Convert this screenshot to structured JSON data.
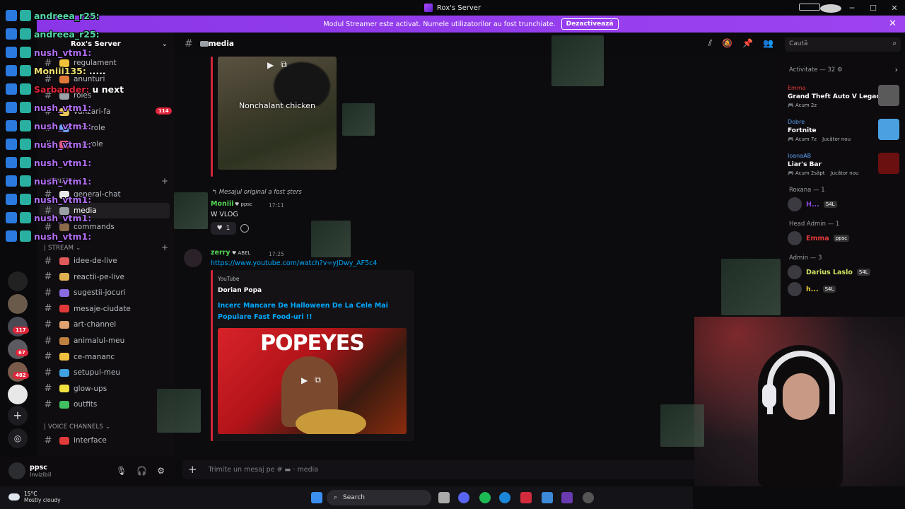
{
  "window": {
    "title": "Rox's Server"
  },
  "banner": {
    "text": "Modul Streamer este activat. Numele utilizatorilor au fost trunchiate.",
    "button": "Dezactivează"
  },
  "rail": {
    "badges": [
      "117",
      "67",
      "482"
    ]
  },
  "server": {
    "name": "Rox's Server",
    "channels_top": [
      {
        "label": "regulament",
        "color": "#f0c23b"
      },
      {
        "label": "anunturi",
        "color": "#e07a3b"
      },
      {
        "label": "roles",
        "color": "#9aa0a6"
      },
      {
        "label": "vanzari-fa",
        "color": "#e7c55a"
      },
      {
        "label": "kick-role",
        "color": "#6aa0f0"
      },
      {
        "label": "self-role",
        "color": "#e05a8a"
      }
    ],
    "unread_badge": "114",
    "cat_general": "| GENERAL |",
    "channels_general": [
      {
        "label": "general-chat",
        "color": "#e7e7e7"
      },
      {
        "label": "media",
        "color": "#9aa0a6"
      },
      {
        "label": "commands",
        "color": "#8a6a4a"
      }
    ],
    "cat_stream": "| STREAM ⌄",
    "channels_stream": [
      {
        "label": "idee-de-live",
        "color": "#e05a5a"
      },
      {
        "label": "reactii-pe-live",
        "color": "#e0b050"
      },
      {
        "label": "sugestii-jocuri",
        "color": "#8a6ae0"
      },
      {
        "label": "mesaje-ciudate",
        "color": "#e03a3a"
      },
      {
        "label": "art-channel",
        "color": "#e0a070"
      },
      {
        "label": "animalul-meu",
        "color": "#c08040"
      },
      {
        "label": "ce-mananc",
        "color": "#f0c040"
      },
      {
        "label": "setupul-meu",
        "color": "#40a0e0"
      },
      {
        "label": "glow-ups",
        "color": "#f0e040"
      },
      {
        "label": "outfits",
        "color": "#40c060"
      }
    ],
    "cat_voice": "| VOICE CHANNELS ⌄",
    "channels_voice": [
      {
        "label": "interface",
        "color": "#e03a3a"
      }
    ]
  },
  "user": {
    "name": "ppsc",
    "status": "Invizibil"
  },
  "header": {
    "channel": "media",
    "search_placeholder": "Caută"
  },
  "messages": {
    "image_caption": "Nonchalant chicken",
    "reply_note": "Mesajul original a fost șters",
    "m1": {
      "author": "Moniii",
      "tag": "ppsc",
      "time": "17:11",
      "text": "W VLOG",
      "reaction_count": "1"
    },
    "m2": {
      "author": "zerry",
      "tag": "ABEL",
      "time": "17:25",
      "link": "https://www.youtube.com/watch?v=yJDwy_AF5c4"
    },
    "embed": {
      "provider": "YouTube",
      "author": "Dorian Popa",
      "title": "Incerc Mancare De Halloween De La Cele Mai Populare Fast Food-uri !!",
      "thumb_brand": "POPEYES"
    }
  },
  "composer": {
    "placeholder": "Trimite un mesaj pe # ▬ · media"
  },
  "members": {
    "activity_title": "Activitate — 32 ⚙",
    "activities": [
      {
        "user": "Emma",
        "user_color": "#e23a3a",
        "game": "Grand Theft Auto V Legacy",
        "meta": "🎮 Acum 2z",
        "extra": "",
        "art": "#5a5a5a"
      },
      {
        "user": "Dobre",
        "user_color": "#5aa0f0",
        "game": "Fortnite",
        "meta": "🎮 Acum 7z",
        "extra": "Jucător nou",
        "art": "#4aa0e0"
      },
      {
        "user": "IoanaAB",
        "user_color": "#5aa0f0",
        "game": "Liar's Bar",
        "meta": "🎮 Acum 2săpt",
        "extra": "Jucător nou",
        "art": "#6a1010"
      }
    ],
    "sections": [
      {
        "title": "Roxana — 1",
        "members": [
          {
            "name": "H...",
            "color": "#8a4ae0",
            "tag": "S4L"
          }
        ]
      },
      {
        "title": "Head Admin — 1",
        "members": [
          {
            "name": "Emma",
            "color": "#e23a3a",
            "tag": "ppsc"
          }
        ]
      },
      {
        "title": "Admin — 3",
        "members": [
          {
            "name": "Darius Laslo",
            "color": "#d0e060",
            "tag": "S4L"
          },
          {
            "name": "h...",
            "color": "#f0d040",
            "tag": "S4L",
            "sub": "·|"
          }
        ]
      }
    ]
  },
  "overlay": {
    "lines": [
      {
        "name": "andreea_r25:",
        "color": "#55d6a8",
        "msg": ""
      },
      {
        "name": "andreea_r25:",
        "color": "#55d6a8",
        "msg": ""
      },
      {
        "name": "nush_vtm1:",
        "color": "#b06ef0",
        "msg": ""
      },
      {
        "name": "Moniii135:",
        "color": "#f0e070",
        "msg": "....."
      },
      {
        "name": "Sarbander:",
        "color": "#e0253b",
        "msg": "u next"
      },
      {
        "name": "nush_vtm1:",
        "color": "#b06ef0",
        "msg": ""
      },
      {
        "name": "nush_vtm1:",
        "color": "#b06ef0",
        "msg": ""
      },
      {
        "name": "nush_vtm1:",
        "color": "#b06ef0",
        "msg": ""
      },
      {
        "name": "nush_vtm1:",
        "color": "#b06ef0",
        "msg": ""
      },
      {
        "name": "nush_vtm1:",
        "color": "#b06ef0",
        "msg": ""
      },
      {
        "name": "nush_vtm1:",
        "color": "#b06ef0",
        "msg": ""
      },
      {
        "name": "nush_vtm1:",
        "color": "#b06ef0",
        "msg": ""
      },
      {
        "name": "nush_vtm1:",
        "color": "#b06ef0",
        "msg": ""
      }
    ]
  },
  "taskbar": {
    "temp": "15°C",
    "weather": "Mostly cloudy",
    "search": "Search"
  }
}
